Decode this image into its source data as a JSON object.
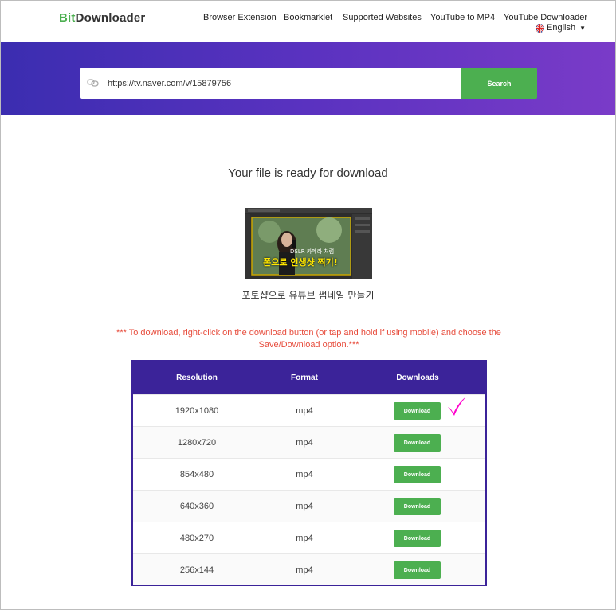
{
  "header": {
    "logo_accent": "Bit",
    "logo_rest": "Downloader",
    "nav": [
      "Browser Extension",
      "Bookmarklet",
      "Supported Websites",
      "YouTube to MP4",
      "YouTube Downloader"
    ],
    "language": "English"
  },
  "search": {
    "value": "https://tv.naver.com/v/15879756",
    "button_label": "Search"
  },
  "main": {
    "ready_title": "Your file is ready for download",
    "thumbnail_text_line1": "DSLR 카메라 처럼",
    "thumbnail_text_line2": "폰으로 인생샷 찍기!",
    "video_title": "포토샵으로 유튜브 썸네일 만들기",
    "note": "*** To download, right-click on the download button (or tap and hold if using mobile) and choose the Save/Download option.***"
  },
  "table": {
    "headers": [
      "Resolution",
      "Format",
      "Downloads"
    ],
    "rows": [
      {
        "resolution": "1920x1080",
        "format": "mp4",
        "button": "Download"
      },
      {
        "resolution": "1280x720",
        "format": "mp4",
        "button": "Download"
      },
      {
        "resolution": "854x480",
        "format": "mp4",
        "button": "Download"
      },
      {
        "resolution": "640x360",
        "format": "mp4",
        "button": "Download"
      },
      {
        "resolution": "480x270",
        "format": "mp4",
        "button": "Download"
      },
      {
        "resolution": "256x144",
        "format": "mp4",
        "button": "Download"
      }
    ]
  },
  "colors": {
    "accent_green": "#4caf50",
    "header_purple": "#3b2399",
    "note_red": "#e74c3c",
    "checkmark_magenta": "#ff00cc"
  }
}
